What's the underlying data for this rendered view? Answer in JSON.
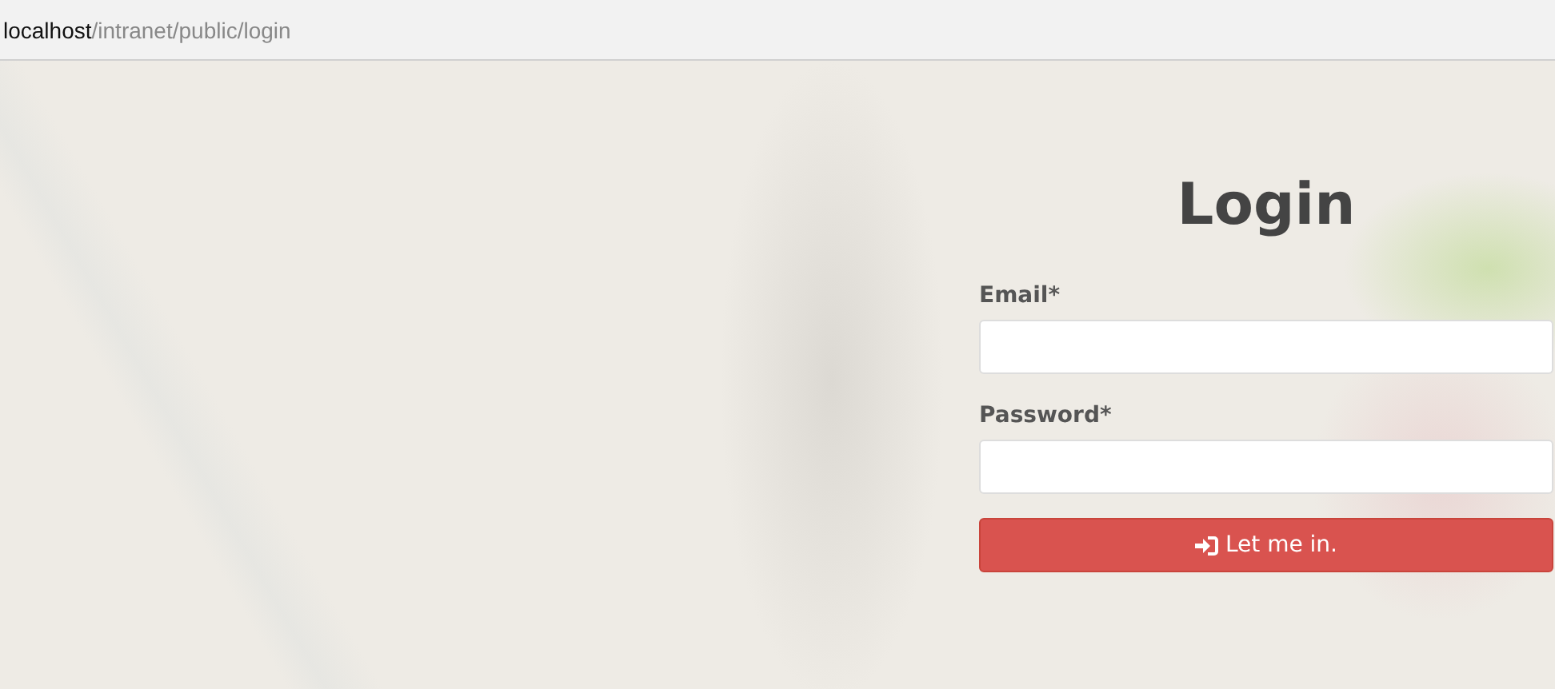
{
  "address_bar": {
    "host": "localhost",
    "path": "/intranet/public/login"
  },
  "login": {
    "title": "Login",
    "fields": [
      {
        "label": "Email*"
      },
      {
        "label": "Password*"
      }
    ],
    "button": {
      "label": "Let me in."
    }
  }
}
